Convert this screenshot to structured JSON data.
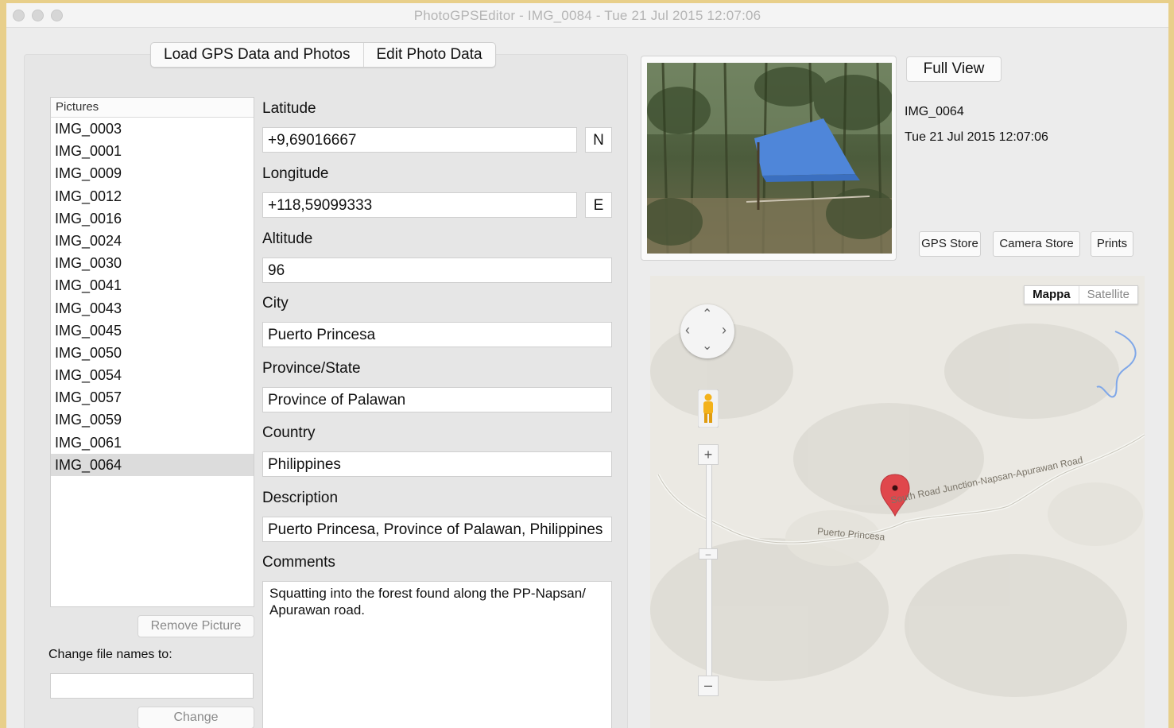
{
  "window": {
    "title": "PhotoGPSEditor - IMG_0084 - Tue 21 Jul 2015 12:07:06"
  },
  "tabs": [
    {
      "label": "Load GPS Data and Photos"
    },
    {
      "label": "Edit Photo Data"
    }
  ],
  "pictures": {
    "header": "Pictures",
    "items": [
      "IMG_0003",
      "IMG_0001",
      "IMG_0009",
      "IMG_0012",
      "IMG_0016",
      "IMG_0024",
      "IMG_0030",
      "IMG_0041",
      "IMG_0043",
      "IMG_0045",
      "IMG_0050",
      "IMG_0054",
      "IMG_0057",
      "IMG_0059",
      "IMG_0061",
      "IMG_0064"
    ],
    "selected": "IMG_0064",
    "remove_label": "Remove Picture",
    "rename_label": "Change file names to:",
    "rename_value": "",
    "change_label": "Change"
  },
  "form": {
    "latitude_label": "Latitude",
    "latitude_value": "+9,69016667",
    "latitude_hemi": "N",
    "longitude_label": "Longitude",
    "longitude_value": "+118,59099333",
    "longitude_hemi": "E",
    "altitude_label": "Altitude",
    "altitude_value": "96",
    "city_label": "City",
    "city_value": "Puerto Princesa",
    "province_label": "Province/State",
    "province_value": "Province of Palawan",
    "country_label": "Country",
    "country_value": "Philippines",
    "description_label": "Description",
    "description_value": "Puerto Princesa, Province of Palawan, Philippines",
    "comments_label": "Comments",
    "comments_value": "Squatting into the forest found along the PP-Napsan/ Apurawan road."
  },
  "preview": {
    "full_view_label": "Full View",
    "photo_name": "IMG_0064",
    "photo_date": "Tue 21 Jul 2015 12:07:06",
    "gps_store_label": "GPS Store",
    "camera_store_label": "Camera Store",
    "prints_label": "Prints"
  },
  "map": {
    "type_map_label": "Mappa",
    "type_satellite_label": "Satellite",
    "road_label_1": "Puerto Princesa",
    "road_label_2": "South Road Junction-Napsan-Apurawan Road"
  },
  "colors": {
    "desktop": "#e8cf8a",
    "tarp_blue": "#4f86d9",
    "pin_red": "#e0474c",
    "pegman_yellow": "#f3b21b"
  }
}
